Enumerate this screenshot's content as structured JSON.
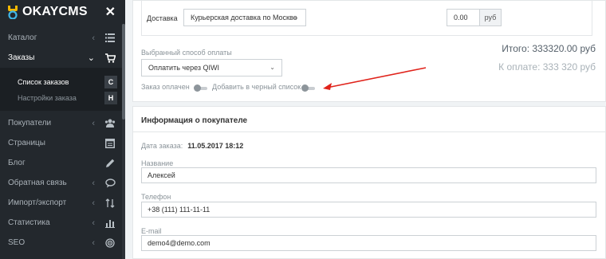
{
  "app": {
    "logo_text": "OKAYCMS"
  },
  "sidebar": {
    "items": [
      {
        "label": "Каталог",
        "icon": "list-icon",
        "chevron": "‹"
      },
      {
        "label": "Заказы",
        "icon": "cart-icon",
        "chevron": "⌄"
      },
      {
        "label": "Покупатели",
        "icon": "users-icon",
        "chevron": "‹"
      },
      {
        "label": "Страницы",
        "icon": "pages-icon",
        "chevron": ""
      },
      {
        "label": "Блог",
        "icon": "pencil-icon",
        "chevron": ""
      },
      {
        "label": "Обратная связь",
        "icon": "chat-icon",
        "chevron": "‹"
      },
      {
        "label": "Импорт/экспорт",
        "icon": "sort-icon",
        "chevron": "‹"
      },
      {
        "label": "Статистика",
        "icon": "bar-chart-icon",
        "chevron": "‹"
      },
      {
        "label": "SEO",
        "icon": "target-icon",
        "chevron": "‹"
      }
    ],
    "submenu": [
      {
        "label": "Список заказов",
        "badge": "C"
      },
      {
        "label": "Настройки заказа",
        "badge": "H"
      }
    ]
  },
  "order": {
    "delivery_label": "Доставка",
    "delivery_value": "Курьерская доставка по Москве",
    "delivery_price": "0.00",
    "currency": "руб",
    "payment_label": "Выбранный способ оплаты",
    "payment_value": "Оплатить через QIWI",
    "paid_label": "Заказ оплачен",
    "blacklist_label": "Добавить в черный список",
    "total": "Итого: 333320.00 руб",
    "to_pay": "К оплате: 333 320 руб"
  },
  "buyer": {
    "section_title": "Информация о покупателе",
    "date_label": "Дата заказа:",
    "date_value": "11.05.2017 18:12",
    "name_label": "Название",
    "name_value": "Алексей",
    "phone_label": "Телефон",
    "phone_value": "+38 (111) 111-11-11",
    "email_label": "E-mail",
    "email_value": "demo4@demo.com"
  },
  "colors": {
    "sidebar_bg": "#23282d",
    "arrow": "#e0231b",
    "logo_accent": "#f5b800"
  }
}
